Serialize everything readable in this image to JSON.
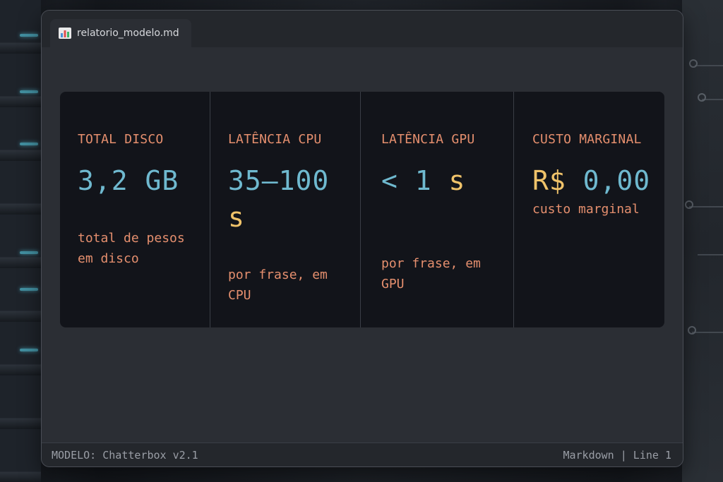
{
  "tab": {
    "icon": "bar-chart-icon",
    "label": "relatorio_modelo.md"
  },
  "stats": [
    {
      "label": "TOTAL DISCO",
      "value_main": "3,2 GB",
      "value_unit": "",
      "desc": "total de pesos em disco"
    },
    {
      "label": "LATÊNCIA CPU",
      "value_main": "35–100",
      "value_unit": "s",
      "desc": "por frase, em CPU"
    },
    {
      "label": "LATÊNCIA GPU",
      "value_main": "< 1",
      "value_unit": "s",
      "desc": "por frase, em GPU"
    },
    {
      "label": "CUSTO MARGINAL",
      "value_currency": "R$",
      "value_main": "0,00",
      "desc": "custo marginal"
    }
  ],
  "status": {
    "left": "MODELO: Chatterbox v2.1",
    "right": "Markdown | Line 1"
  },
  "colors": {
    "label": "#e58f6e",
    "value": "#6fb9cf",
    "unit": "#f0c36a"
  }
}
